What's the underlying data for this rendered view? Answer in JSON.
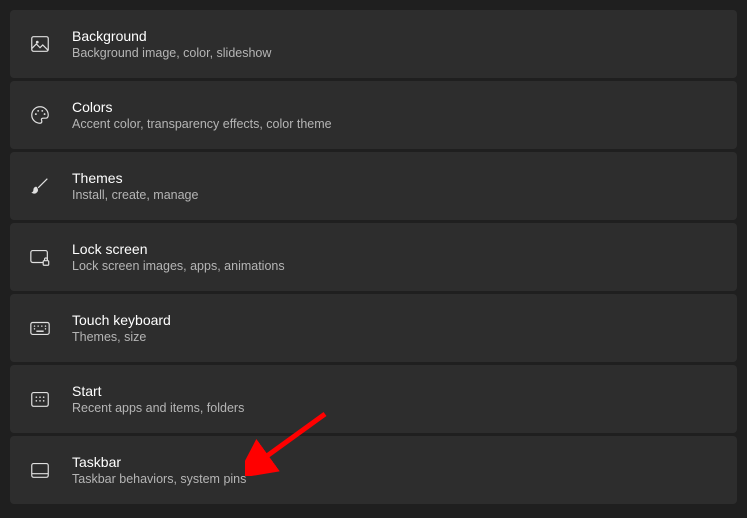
{
  "settings": {
    "items": [
      {
        "title": "Background",
        "subtitle": "Background image, color, slideshow"
      },
      {
        "title": "Colors",
        "subtitle": "Accent color, transparency effects, color theme"
      },
      {
        "title": "Themes",
        "subtitle": "Install, create, manage"
      },
      {
        "title": "Lock screen",
        "subtitle": "Lock screen images, apps, animations"
      },
      {
        "title": "Touch keyboard",
        "subtitle": "Themes, size"
      },
      {
        "title": "Start",
        "subtitle": "Recent apps and items, folders"
      },
      {
        "title": "Taskbar",
        "subtitle": "Taskbar behaviors, system pins"
      }
    ]
  },
  "annotation": {
    "arrow_color": "#ff0000"
  }
}
